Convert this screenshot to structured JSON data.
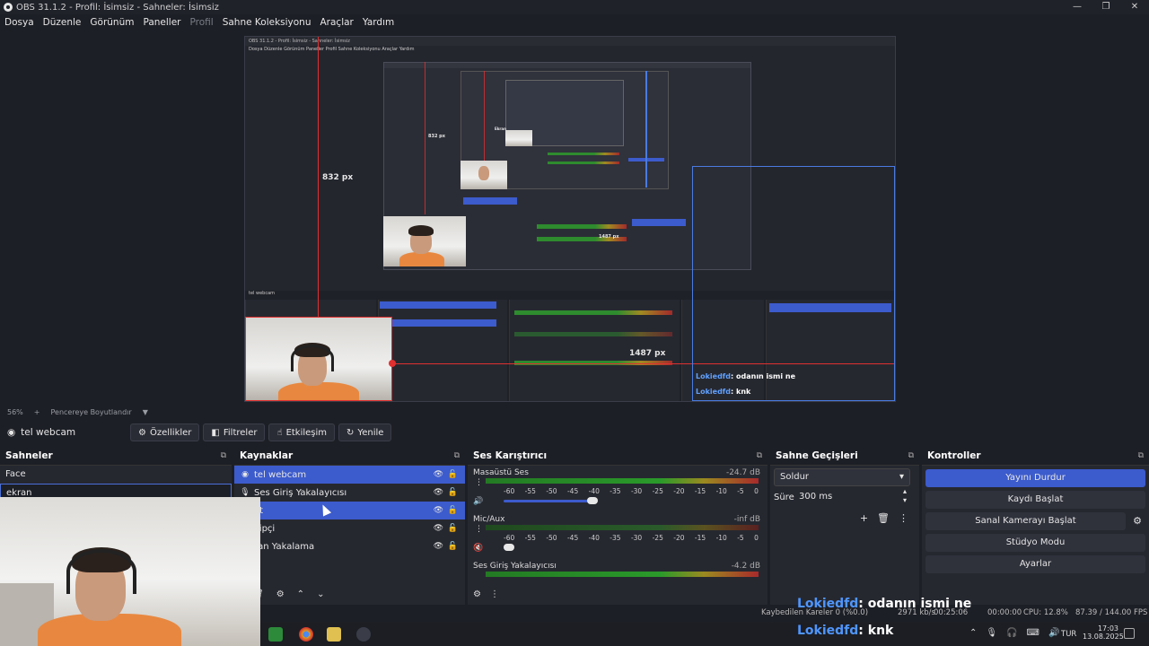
{
  "window": {
    "title": "OBS 31.1.2 - Profil: İsimsiz - Sahneler: İsimsiz"
  },
  "menu": [
    {
      "label": "Dosya",
      "enabled": true
    },
    {
      "label": "Düzenle",
      "enabled": true
    },
    {
      "label": "Görünüm",
      "enabled": true
    },
    {
      "label": "Paneller",
      "enabled": true
    },
    {
      "label": "Profil",
      "enabled": false
    },
    {
      "label": "Sahne Koleksiyonu",
      "enabled": true
    },
    {
      "label": "Araçlar",
      "enabled": true
    },
    {
      "label": "Yardım",
      "enabled": true
    }
  ],
  "preview": {
    "measure_vertical": "832 px",
    "measure_horizontal": "1487 px",
    "inner_measure_vertical": "832 px",
    "inner_measure_horizontal": "1487 px",
    "inner_label": "Ekran",
    "chat": [
      {
        "name": "Lokiedfd",
        "text": ": odanın ismi ne"
      },
      {
        "name": "Lokiedfd",
        "text": ": knk"
      }
    ]
  },
  "zoombar": {
    "zoom": "56%",
    "add": "+",
    "fit": "Pencereye Boyutlandır"
  },
  "source_toolbar": {
    "current_source": "tel webcam",
    "buttons": [
      {
        "label": "Özellikler",
        "icon": "gear-icon",
        "glyph": "⚙"
      },
      {
        "label": "Filtreler",
        "icon": "filter-icon",
        "glyph": "◧"
      },
      {
        "label": "Etkileşim",
        "icon": "interact-icon",
        "glyph": "☝"
      },
      {
        "label": "Yenile",
        "icon": "refresh-icon",
        "glyph": "↻"
      }
    ]
  },
  "scenes": {
    "title": "Sahneler",
    "items": [
      {
        "label": "Face",
        "active": false
      },
      {
        "label": "ekran",
        "active": true
      }
    ]
  },
  "sources": {
    "title": "Kaynaklar",
    "items": [
      {
        "label": "tel webcam",
        "selected": true,
        "icon": "globe-icon"
      },
      {
        "label": "Ses Giriş Yakalayıcısı",
        "selected": false,
        "icon": "mic-icon"
      },
      {
        "label": "at",
        "selected": true,
        "icon": ""
      },
      {
        "label": "kipçi",
        "selected": false,
        "icon": ""
      },
      {
        "label": "ran Yakalama",
        "selected": false,
        "icon": ""
      }
    ]
  },
  "mixer": {
    "title": "Ses Karıştırıcı",
    "ticks": [
      "-60",
      "-55",
      "-50",
      "-45",
      "-40",
      "-35",
      "-30",
      "-25",
      "-20",
      "-15",
      "-10",
      "-5",
      "0"
    ],
    "channels": [
      {
        "name": "Masaüstü Ses",
        "db": "-24.7 dB",
        "volume": 0.9
      },
      {
        "name": "Mic/Aux",
        "db": "-inf dB",
        "volume": 0.05
      },
      {
        "name": "Ses Giriş Yakalayıcısı",
        "db": "-4.2 dB",
        "volume": 0.9
      }
    ]
  },
  "transitions": {
    "title": "Sahne Geçişleri",
    "selected": "Soldur",
    "duration_label": "Süre",
    "duration_value": "300 ms"
  },
  "controls": {
    "title": "Kontroller",
    "buttons": [
      {
        "label": "Yayını Durdur",
        "primary": true
      },
      {
        "label": "Kaydı Başlat",
        "primary": false
      },
      {
        "label": "Sanal Kamerayı Başlat",
        "primary": false
      },
      {
        "label": "Stüdyo Modu",
        "primary": false
      },
      {
        "label": "Ayarlar",
        "primary": false
      }
    ]
  },
  "status": {
    "dropped_frames": "Kaybedilen Kareler 0 (%0.0)",
    "bitrate": "2971 kb/s",
    "stream_time": "00:25:06",
    "rec_time": "00:00:00",
    "cpu": "CPU: 12.8%",
    "fps": "87.39 / 144.00 FPS"
  },
  "overlay_chat": [
    {
      "name": "Lokiedfd",
      "text": ": odanın ismi ne"
    },
    {
      "name": "Lokiedfd",
      "text": ": knk"
    }
  ],
  "taskbar": {
    "lang": "TUR",
    "time": "17:03",
    "date": "13.08.2025"
  }
}
